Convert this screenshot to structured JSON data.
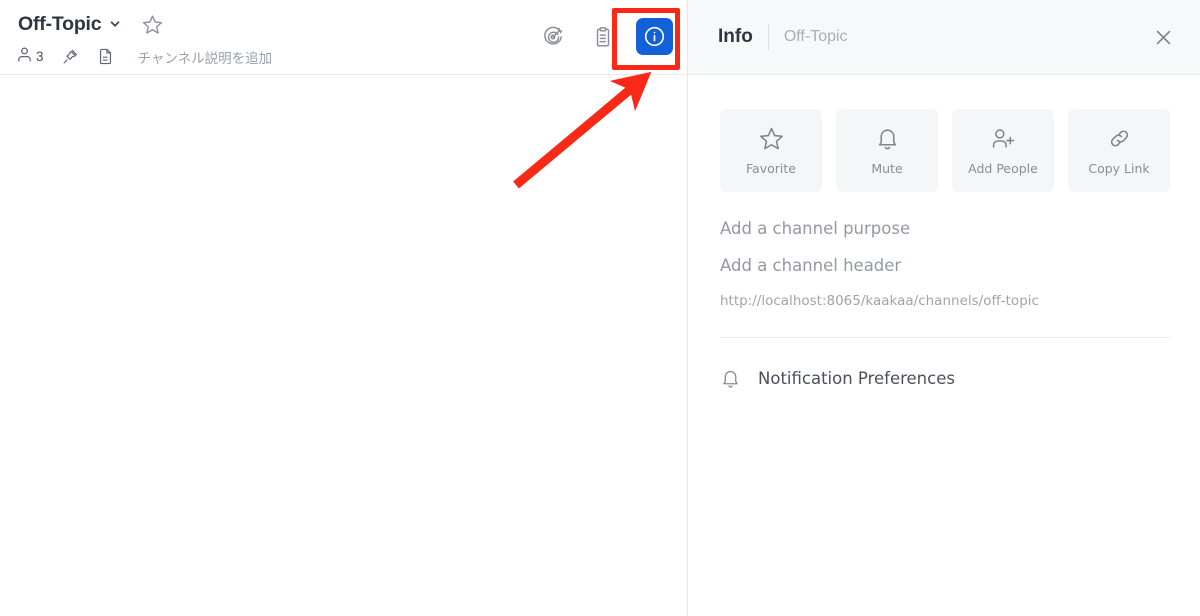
{
  "channel": {
    "name": "Off-Topic",
    "chevron_icon": "chevron-down-icon",
    "favorite_icon": "star-outline-icon",
    "members_icon": "person-icon",
    "member_count": "3",
    "pin_icon": "pin-icon",
    "files_icon": "file-document-icon",
    "description_placeholder": "チャンネル説明を追加",
    "actions": [
      {
        "icon": "target-icon",
        "name": "channel-goals-button",
        "active": false
      },
      {
        "icon": "clipboard-list-icon",
        "name": "pinned-posts-button",
        "active": false
      },
      {
        "icon": "info-circle-icon",
        "name": "channel-info-button",
        "active": true
      }
    ]
  },
  "info_panel": {
    "title": "Info",
    "subtitle": "Off-Topic",
    "close_icon": "close-icon",
    "quick_actions": [
      {
        "label": "Favorite",
        "icon": "star-outline-icon",
        "name": "favorite-button"
      },
      {
        "label": "Mute",
        "icon": "bell-icon",
        "name": "mute-button"
      },
      {
        "label": "Add People",
        "icon": "person-add-icon",
        "name": "add-people-button"
      },
      {
        "label": "Copy Link",
        "icon": "link-icon",
        "name": "copy-link-button"
      }
    ],
    "purpose_prompt": "Add a channel purpose",
    "header_prompt": "Add a channel header",
    "channel_url": "http://localhost:8065/kaakaa/channels/off-topic",
    "notification_preferences": {
      "label": "Notification Preferences",
      "icon": "bell-icon"
    }
  },
  "annotation": {
    "highlight_color": "#f82a17",
    "arrow_icon": "arrow-pointer-icon",
    "target": "channel-info-button"
  }
}
